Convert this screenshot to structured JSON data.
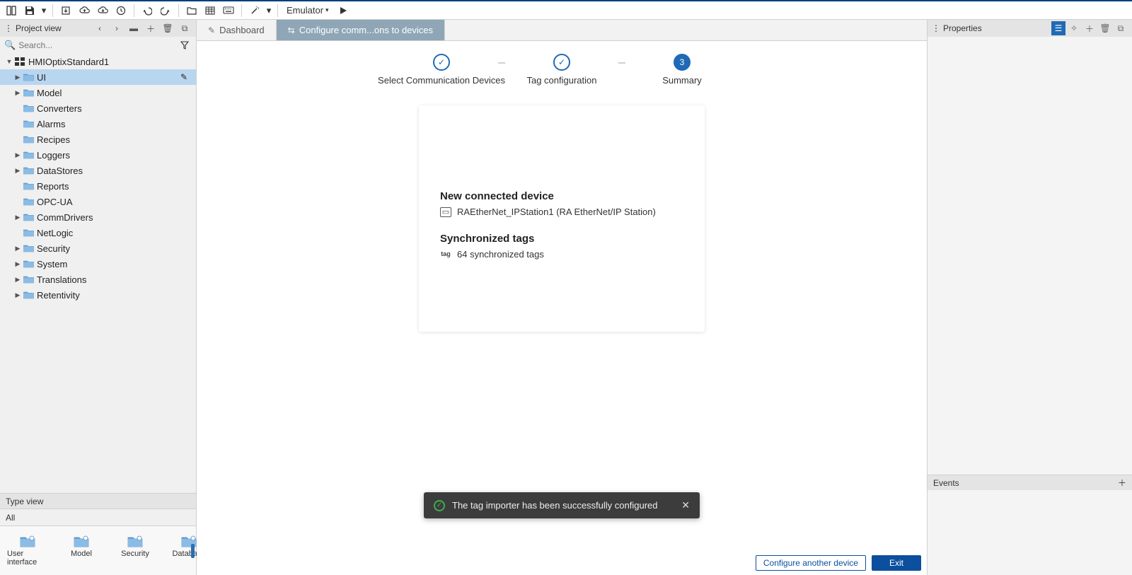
{
  "toolbar": {
    "emulator_label": "Emulator"
  },
  "project_panel": {
    "title": "Project view",
    "search_placeholder": "Search...",
    "root": "HMIOptixStandard1",
    "items": [
      {
        "label": "UI",
        "expandable": true,
        "selected": true,
        "edit": true
      },
      {
        "label": "Model",
        "expandable": true
      },
      {
        "label": "Converters",
        "expandable": false
      },
      {
        "label": "Alarms",
        "expandable": false
      },
      {
        "label": "Recipes",
        "expandable": false
      },
      {
        "label": "Loggers",
        "expandable": true
      },
      {
        "label": "DataStores",
        "expandable": true
      },
      {
        "label": "Reports",
        "expandable": false
      },
      {
        "label": "OPC-UA",
        "expandable": false
      },
      {
        "label": "CommDrivers",
        "expandable": true
      },
      {
        "label": "NetLogic",
        "expandable": false
      },
      {
        "label": "Security",
        "expandable": true
      },
      {
        "label": "System",
        "expandable": true
      },
      {
        "label": "Translations",
        "expandable": true
      },
      {
        "label": "Retentivity",
        "expandable": true
      }
    ]
  },
  "type_view": {
    "title": "Type view",
    "tab": "All",
    "items": [
      {
        "label": "User interface"
      },
      {
        "label": "Model"
      },
      {
        "label": "Security"
      },
      {
        "label": "Database"
      }
    ]
  },
  "tabs": [
    {
      "label": "Dashboard",
      "active": false
    },
    {
      "label": "Configure comm...ons to devices",
      "active": true
    }
  ],
  "wizard": {
    "steps": [
      {
        "label": "Select Communication Devices",
        "state": "done"
      },
      {
        "label": "Tag configuration",
        "state": "done"
      },
      {
        "label": "Summary",
        "state": "current",
        "num": "3"
      }
    ],
    "summary": {
      "device_title": "New connected device",
      "device_name": "RAEtherNet_IPStation1 (RA EtherNet/IP Station)",
      "tags_title": "Synchronized tags",
      "tags_text": "64 synchronized tags"
    },
    "toast": "The tag importer has been successfully configured",
    "buttons": {
      "another": "Configure another device",
      "exit": "Exit"
    }
  },
  "properties": {
    "title": "Properties"
  },
  "events": {
    "title": "Events"
  }
}
